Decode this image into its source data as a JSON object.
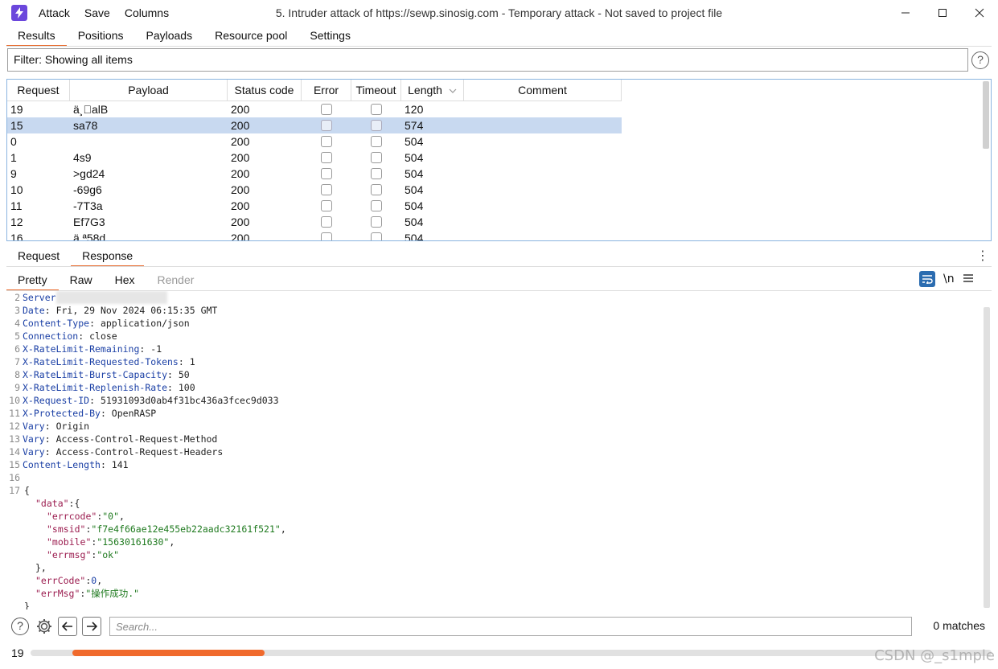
{
  "app": {
    "menu": [
      "Attack",
      "Save",
      "Columns"
    ],
    "window_title": "5. Intruder attack of https://sewp.sinosig.com - Temporary attack - Not saved to project file"
  },
  "main_tabs": [
    "Results",
    "Positions",
    "Payloads",
    "Resource pool",
    "Settings"
  ],
  "filter": {
    "text": "Filter: Showing all items"
  },
  "table": {
    "columns": [
      "Request",
      "Payload",
      "Status code",
      "Error",
      "Timeout",
      "Length",
      "Comment"
    ],
    "sort_indicator": "chevron-down",
    "rows": [
      {
        "request": "19",
        "payload": "ä¸\u0000alB",
        "status": "200",
        "length": "120",
        "selected": false
      },
      {
        "request": "15",
        "payload": "sa78",
        "status": "200",
        "length": "574",
        "selected": true
      },
      {
        "request": "0",
        "payload": "",
        "status": "200",
        "length": "504",
        "selected": false
      },
      {
        "request": "1",
        "payload": "4s9",
        "status": "200",
        "length": "504",
        "selected": false
      },
      {
        "request": "9",
        "payload": ">gd24",
        "status": "200",
        "length": "504",
        "selected": false
      },
      {
        "request": "10",
        "payload": "-69g6",
        "status": "200",
        "length": "504",
        "selected": false
      },
      {
        "request": "11",
        "payload": "-7T3a",
        "status": "200",
        "length": "504",
        "selected": false
      },
      {
        "request": "12",
        "payload": "Ef7G3",
        "status": "200",
        "length": "504",
        "selected": false
      },
      {
        "request": "16",
        "payload": "ä ª58d",
        "status": "200",
        "length": "504",
        "selected": false
      }
    ]
  },
  "sub_tabs": [
    "Request",
    "Response"
  ],
  "view_tabs": [
    "Pretty",
    "Raw",
    "Hex",
    "Render"
  ],
  "editor": {
    "newline_toggle": "\\n",
    "lines": [
      {
        "n": "2",
        "key": "Server",
        "sep": "",
        "val": ""
      },
      {
        "n": "3",
        "key": "Date",
        "sep": ": ",
        "val": "Fri, 29 Nov 2024 06:15:35 GMT"
      },
      {
        "n": "4",
        "key": "Content-Type",
        "sep": ": ",
        "val": "application/json"
      },
      {
        "n": "5",
        "key": "Connection",
        "sep": ": ",
        "val": "close"
      },
      {
        "n": "6",
        "key": "X-RateLimit-Remaining",
        "sep": ": ",
        "val": "-1"
      },
      {
        "n": "7",
        "key": "X-RateLimit-Requested-Tokens",
        "sep": ": ",
        "val": "1"
      },
      {
        "n": "8",
        "key": "X-RateLimit-Burst-Capacity",
        "sep": ": ",
        "val": "50"
      },
      {
        "n": "9",
        "key": "X-RateLimit-Replenish-Rate",
        "sep": ": ",
        "val": "100"
      },
      {
        "n": "10",
        "key": "X-Request-ID",
        "sep": ": ",
        "val": "51931093d0ab4f31bc436a3fcec9d033"
      },
      {
        "n": "11",
        "key": "X-Protected-By",
        "sep": ": ",
        "val": "OpenRASP"
      },
      {
        "n": "12",
        "key": "Vary",
        "sep": ": ",
        "val": "Origin"
      },
      {
        "n": "13",
        "key": "Vary",
        "sep": ": ",
        "val": "Access-Control-Request-Method"
      },
      {
        "n": "14",
        "key": "Vary",
        "sep": ": ",
        "val": "Access-Control-Request-Headers"
      },
      {
        "n": "15",
        "key": "Content-Length",
        "sep": ": ",
        "val": "141"
      },
      {
        "n": "16",
        "key": "",
        "sep": "",
        "val": ""
      }
    ],
    "json_lines": [
      {
        "n": "17",
        "text": "{"
      },
      {
        "n": "",
        "key": "\"data\"",
        "rest": ":{",
        "indent": 1
      },
      {
        "n": "",
        "key": "\"errcode\"",
        "str": "\"0\"",
        "trail": ",",
        "indent": 2
      },
      {
        "n": "",
        "key": "\"smsid\"",
        "str": "\"f7e4f66ae12e455eb22aadc32161f521\"",
        "trail": ",",
        "indent": 2
      },
      {
        "n": "",
        "key": "\"mobile\"",
        "str": "\"15630161630\"",
        "trail": ",",
        "indent": 2
      },
      {
        "n": "",
        "key": "\"errmsg\"",
        "str": "\"ok\"",
        "trail": "",
        "indent": 2
      },
      {
        "n": "",
        "text": "},",
        "indent": 1
      },
      {
        "n": "",
        "key": "\"errCode\"",
        "num": "0",
        "trail": ",",
        "indent": 1
      },
      {
        "n": "",
        "key": "\"errMsg\"",
        "str": "\"操作成功.\"",
        "trail": "",
        "indent": 1
      },
      {
        "n": "",
        "text": "}"
      }
    ]
  },
  "search": {
    "placeholder": "Search...",
    "matches": "0 matches"
  },
  "status": {
    "count": "19",
    "progress": 0.2
  },
  "watermark": "CSDN @_s1mple",
  "colors": {
    "accent": "#e86a2c",
    "selection": "#c8d9f0",
    "app_icon": "#6b47dc"
  }
}
